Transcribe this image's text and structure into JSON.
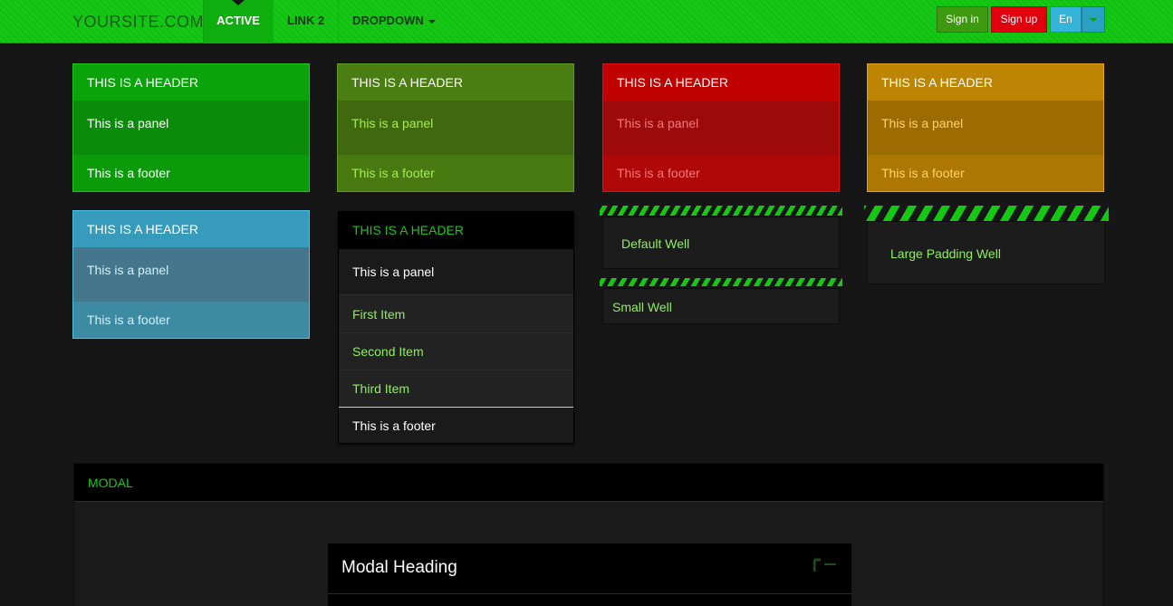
{
  "navbar": {
    "brand": "YOURSITE.COM",
    "items": [
      {
        "label": "ACTIVE"
      },
      {
        "label": "LINK 2"
      },
      {
        "label": "DROPDOWN"
      }
    ],
    "buttons": {
      "signin": "Sign in",
      "signup": "Sign up",
      "language": "En"
    }
  },
  "panels": [
    {
      "header": "This is a header",
      "body": "This is a panel",
      "footer": "This is a footer",
      "color": "#0aa40a"
    },
    {
      "header": "This is a header",
      "body": "This is a panel",
      "footer": "This is a footer",
      "color": "#4a7e12"
    },
    {
      "header": "This is a header",
      "body": "This is a panel",
      "footer": "This is a footer",
      "color": "#bf0101"
    },
    {
      "header": "This is a header",
      "body": "This is a panel",
      "footer": "This is a footer",
      "color": "#bd8503"
    },
    {
      "header": "This is a header",
      "body": "This is a panel",
      "footer": "This is a footer",
      "color": "#379bbb"
    }
  ],
  "list_panel": {
    "header": "This is a header",
    "body": "This is a panel",
    "items": [
      "First Item",
      "Second Item",
      "Third Item"
    ],
    "footer": "This is a footer"
  },
  "wells": {
    "default": "Default Well",
    "small": "Small Well",
    "large": "Large Padding Well"
  },
  "modal_section": {
    "header": "Modal",
    "modal_heading": "Modal Heading"
  }
}
